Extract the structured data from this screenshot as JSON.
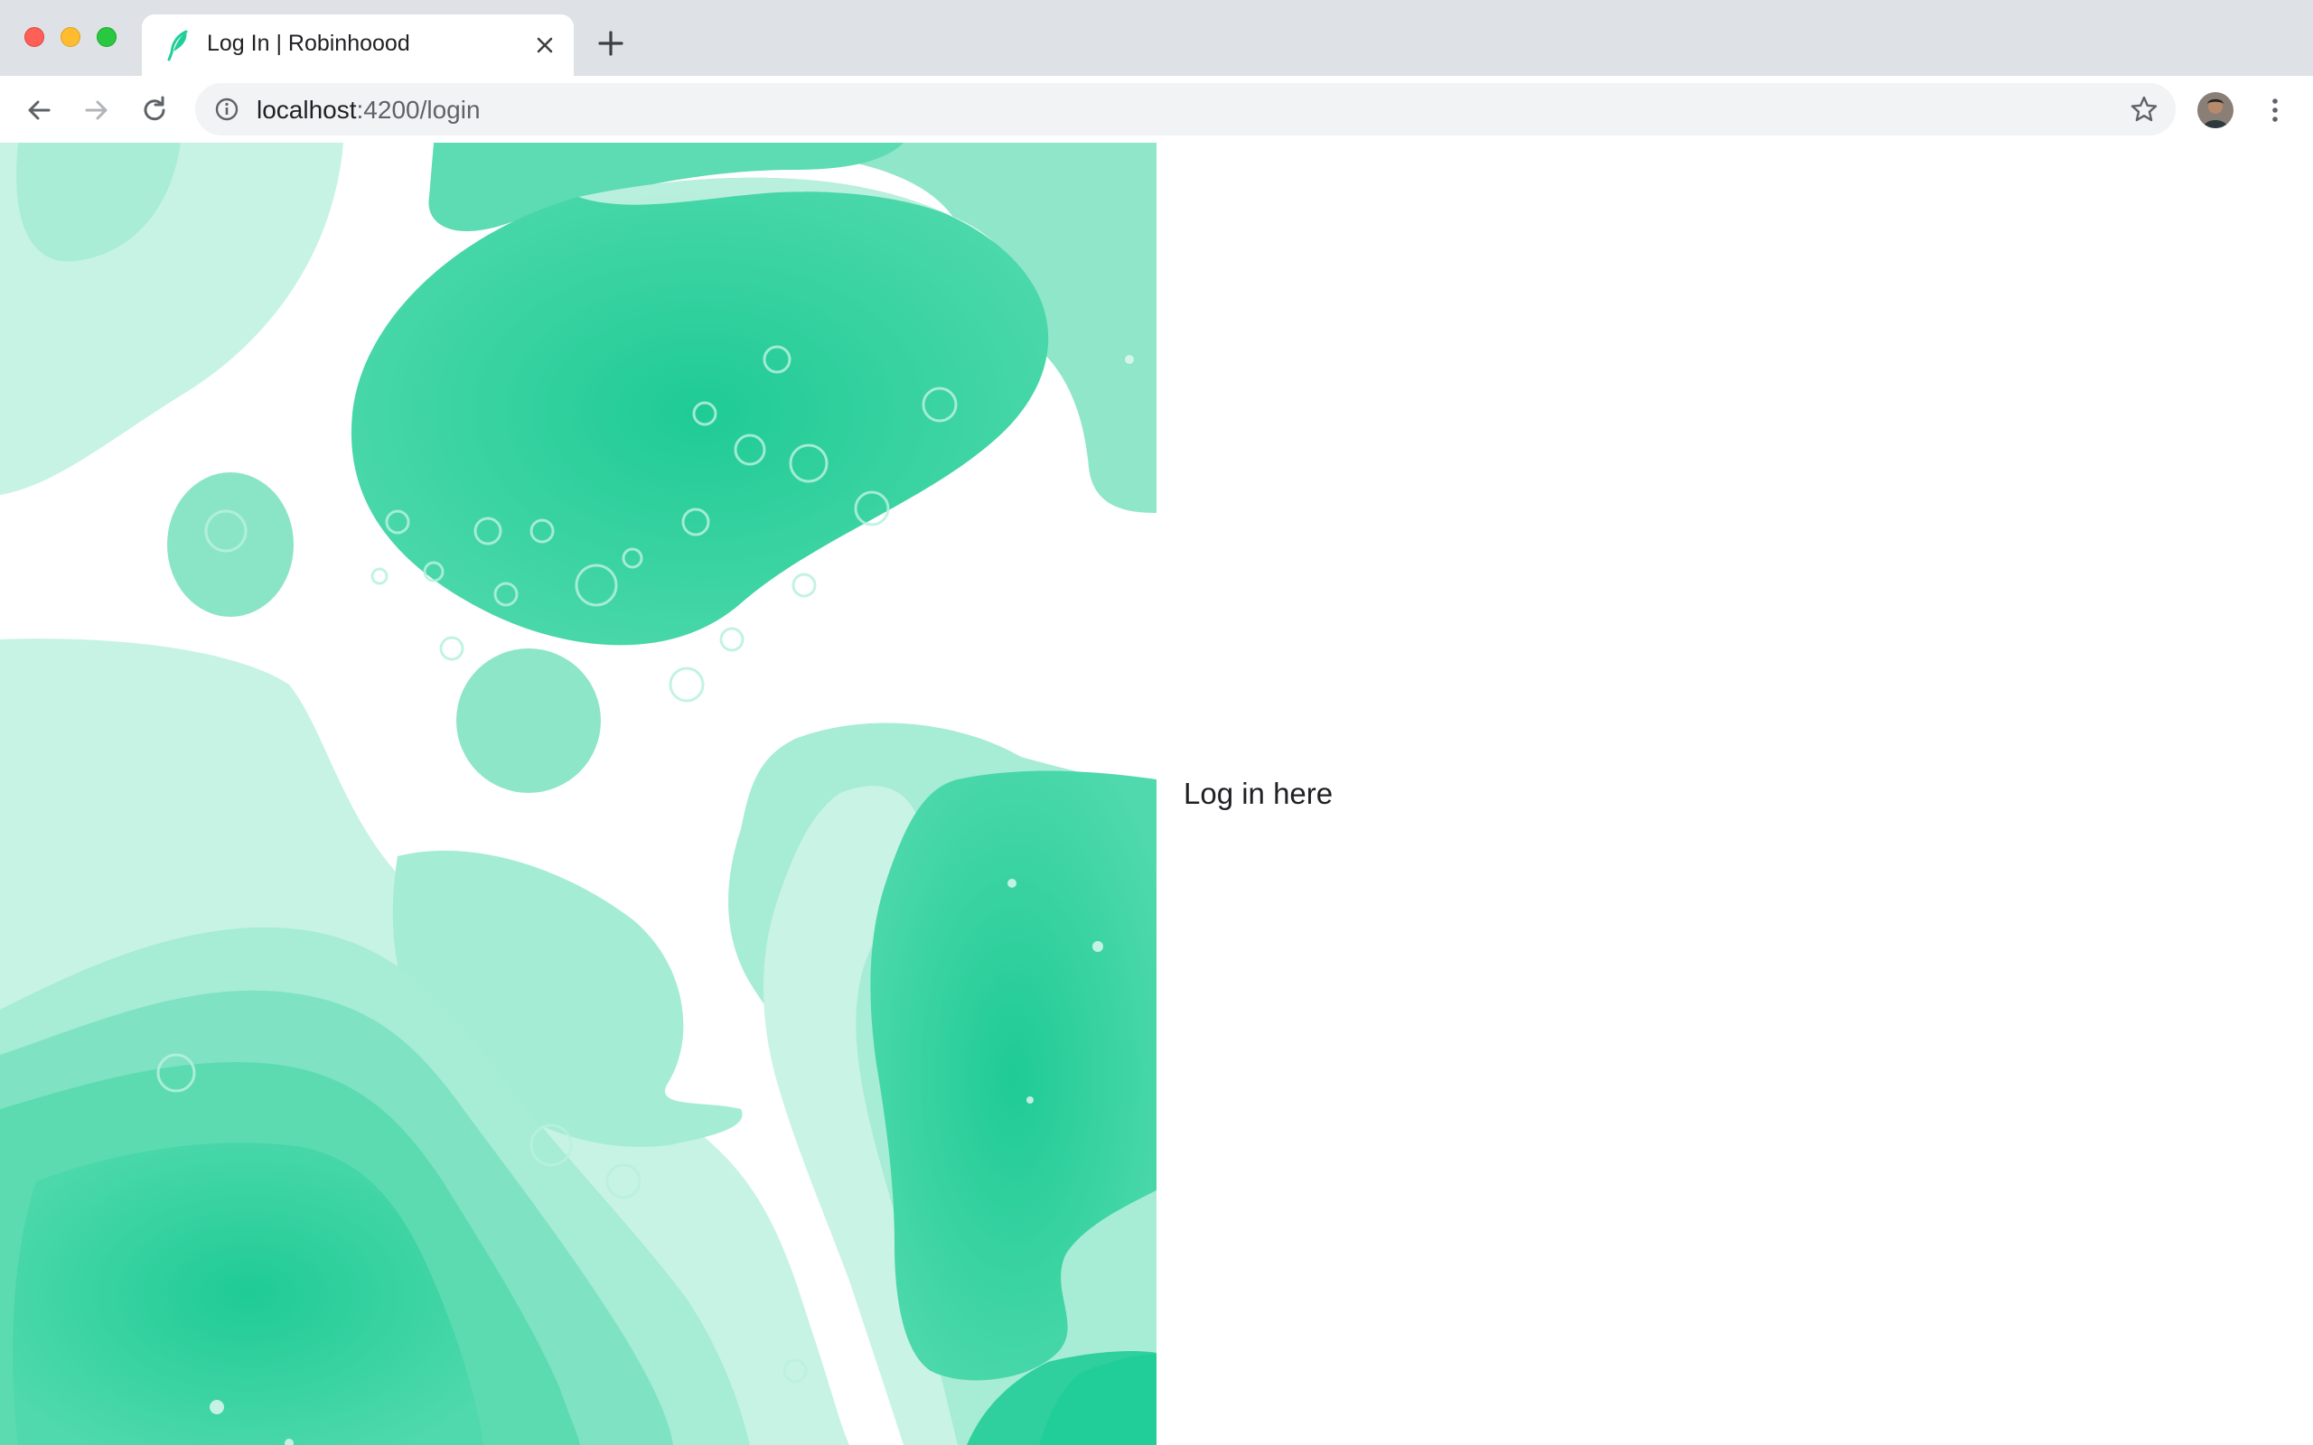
{
  "window": {
    "controls": [
      "close",
      "minimize",
      "maximize"
    ]
  },
  "tab": {
    "title": "Log In | Robinhoood",
    "favicon": "robinhood-feather-icon",
    "close_icon": "close-icon"
  },
  "new_tab_icon": "plus-icon",
  "toolbar": {
    "back_icon": "arrow-left-icon",
    "forward_icon": "arrow-right-icon",
    "reload_icon": "reload-icon",
    "info_icon": "info-icon",
    "url_host": "localhost",
    "url_path": ":4200/login",
    "bookmark_icon": "star-icon",
    "menu_icon": "kebab-menu-icon"
  },
  "main": {
    "hero_image": "abstract-green-fluid-art",
    "login_text": "Log in here"
  },
  "colors": {
    "brand_green": "#21ce99",
    "mint_light": "#b3eedb",
    "mint_mid": "#7fe3c3",
    "tab_strip": "#dee1e6",
    "omnibox": "#f1f3f4"
  }
}
